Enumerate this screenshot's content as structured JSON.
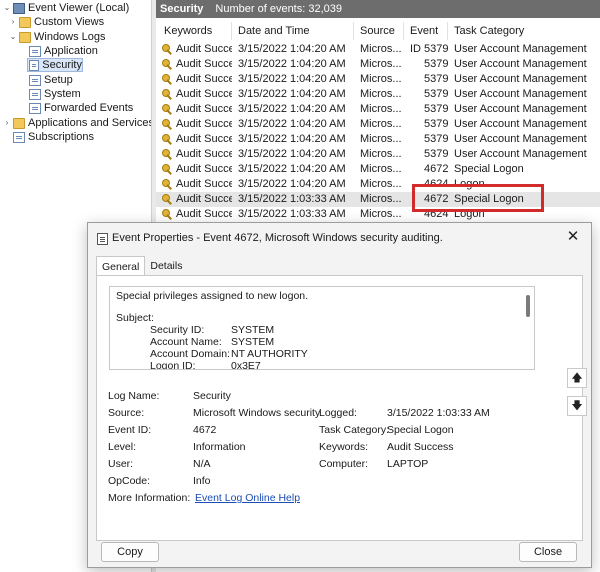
{
  "tree": {
    "items": [
      {
        "label": "Event Viewer (Local)",
        "expander": "⌄"
      },
      {
        "label": "Custom Views",
        "expander": "›"
      },
      {
        "label": "Windows Logs",
        "expander": "⌄"
      },
      {
        "label": "Application",
        "expander": ""
      },
      {
        "label": "Security",
        "expander": ""
      },
      {
        "label": "Setup",
        "expander": ""
      },
      {
        "label": "System",
        "expander": ""
      },
      {
        "label": "Forwarded Events",
        "expander": ""
      },
      {
        "label": "Applications and Services Lo",
        "expander": "›"
      },
      {
        "label": "Subscriptions",
        "expander": ""
      }
    ]
  },
  "list": {
    "title": "Security",
    "count": "Number of events: 32,039",
    "columns": [
      "Keywords",
      "Date and Time",
      "Source",
      "Event ID",
      "Task Category"
    ],
    "rows": [
      {
        "keywords": "Audit Succe...",
        "date": "3/15/2022 1:04:20 AM",
        "source": "Micros...",
        "event_id": "5379",
        "task": "User Account Management"
      },
      {
        "keywords": "Audit Succe...",
        "date": "3/15/2022 1:04:20 AM",
        "source": "Micros...",
        "event_id": "5379",
        "task": "User Account Management"
      },
      {
        "keywords": "Audit Succe...",
        "date": "3/15/2022 1:04:20 AM",
        "source": "Micros...",
        "event_id": "5379",
        "task": "User Account Management"
      },
      {
        "keywords": "Audit Succe...",
        "date": "3/15/2022 1:04:20 AM",
        "source": "Micros...",
        "event_id": "5379",
        "task": "User Account Management"
      },
      {
        "keywords": "Audit Succe...",
        "date": "3/15/2022 1:04:20 AM",
        "source": "Micros...",
        "event_id": "5379",
        "task": "User Account Management"
      },
      {
        "keywords": "Audit Succe...",
        "date": "3/15/2022 1:04:20 AM",
        "source": "Micros...",
        "event_id": "5379",
        "task": "User Account Management"
      },
      {
        "keywords": "Audit Succe...",
        "date": "3/15/2022 1:04:20 AM",
        "source": "Micros...",
        "event_id": "5379",
        "task": "User Account Management"
      },
      {
        "keywords": "Audit Succe...",
        "date": "3/15/2022 1:04:20 AM",
        "source": "Micros...",
        "event_id": "5379",
        "task": "User Account Management"
      },
      {
        "keywords": "Audit Succe...",
        "date": "3/15/2022 1:04:20 AM",
        "source": "Micros...",
        "event_id": "4672",
        "task": "Special Logon"
      },
      {
        "keywords": "Audit Succe...",
        "date": "3/15/2022 1:04:20 AM",
        "source": "Micros...",
        "event_id": "4624",
        "task": "Logon"
      },
      {
        "keywords": "Audit Succe...",
        "date": "3/15/2022 1:03:33 AM",
        "source": "Micros...",
        "event_id": "4672",
        "task": "Special Logon"
      },
      {
        "keywords": "Audit Succe...",
        "date": "3/15/2022 1:03:33 AM",
        "source": "Micros...",
        "event_id": "4624",
        "task": "Logon"
      }
    ]
  },
  "dialog": {
    "title": "Event Properties - Event 4672, Microsoft Windows security auditing.",
    "close_glyph": "✕",
    "tabs": [
      "General",
      "Details"
    ],
    "description": {
      "line1": "Special privileges assigned to new logon.",
      "subject_label": "Subject:",
      "rows": [
        {
          "label": "Security ID:",
          "value": "SYSTEM"
        },
        {
          "label": "Account Name:",
          "value": "SYSTEM"
        },
        {
          "label": "Account Domain:",
          "value": "NT AUTHORITY"
        },
        {
          "label": "Logon ID:",
          "value": "0x3E7"
        }
      ]
    },
    "side_buttons": {
      "up": "🡅",
      "down": "🡇"
    },
    "fields": {
      "log_name_label": "Log Name:",
      "log_name": "Security",
      "source_label": "Source:",
      "source": "Microsoft Windows security",
      "logged_label": "Logged:",
      "logged": "3/15/2022 1:03:33 AM",
      "event_id_label": "Event ID:",
      "event_id": "4672",
      "task_category_label": "Task Category:",
      "task_category": "Special Logon",
      "level_label": "Level:",
      "level": "Information",
      "keywords_label": "Keywords:",
      "keywords": "Audit Success",
      "user_label": "User:",
      "user": "N/A",
      "computer_label": "Computer:",
      "computer": "LAPTOP",
      "opcode_label": "OpCode:",
      "opcode": "Info",
      "more_info_label": "More Information:",
      "more_info_link": "Event Log Online Help"
    },
    "copy_label": "Copy",
    "close_label": "Close"
  },
  "colors": {
    "highlight": "#d22b2b",
    "header_bar": "#6d6d6d",
    "link": "#1a4db5"
  }
}
